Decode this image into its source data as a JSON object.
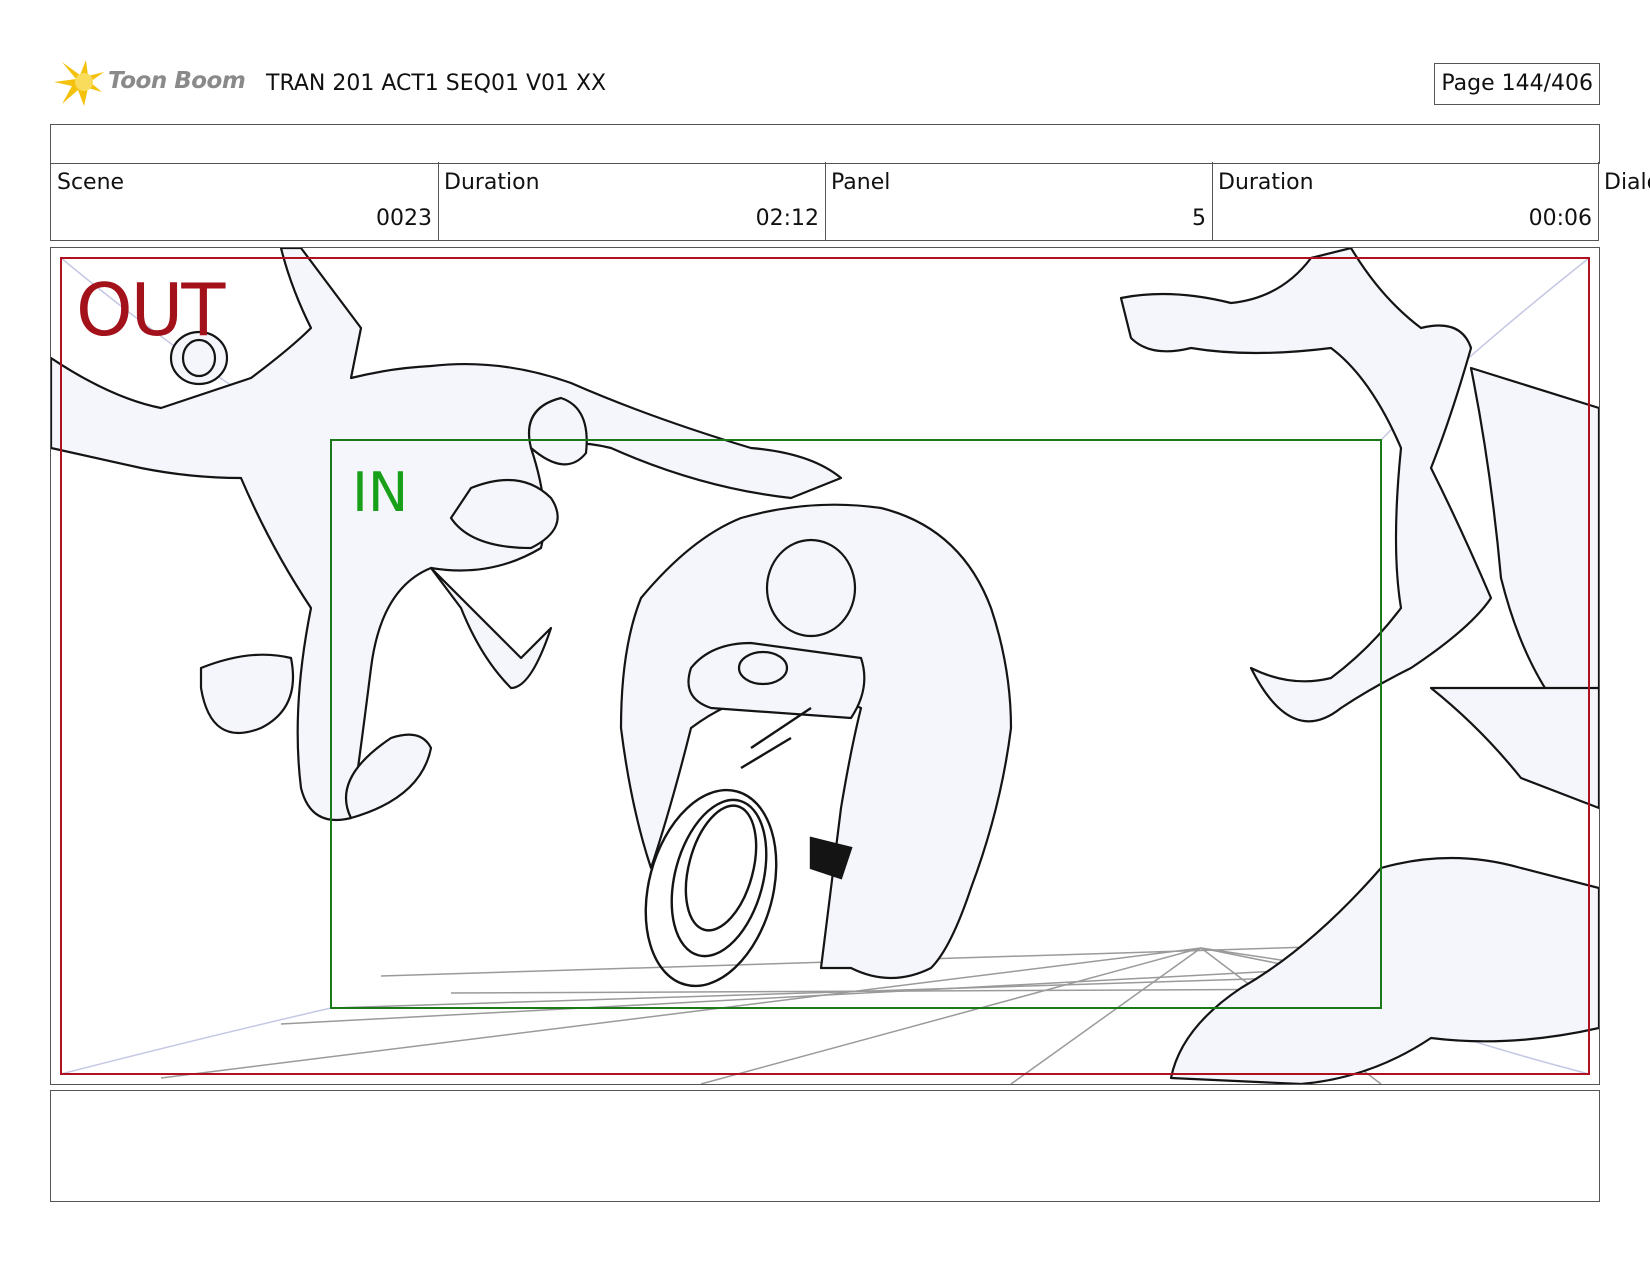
{
  "header": {
    "logo_text": "Toon Boom",
    "title": "TRAN 201 ACT1 SEQ01 V01 XX",
    "page": "Page 144/406"
  },
  "fields": {
    "scene_label": "Scene",
    "scene_value": "0023",
    "scene_duration_label": "Duration",
    "scene_duration_value": "02:12",
    "panel_label": "Panel",
    "panel_value": "5",
    "panel_duration_label": "Duration",
    "panel_duration_value": "00:06",
    "dialog_label": "Dialo"
  },
  "panel": {
    "out_label": "OUT",
    "in_label": "IN"
  },
  "colors": {
    "out_frame": "#b01020",
    "in_frame": "#1a7a1a",
    "sketch_fill": "#f4f6fb",
    "sketch_line": "#141414"
  }
}
